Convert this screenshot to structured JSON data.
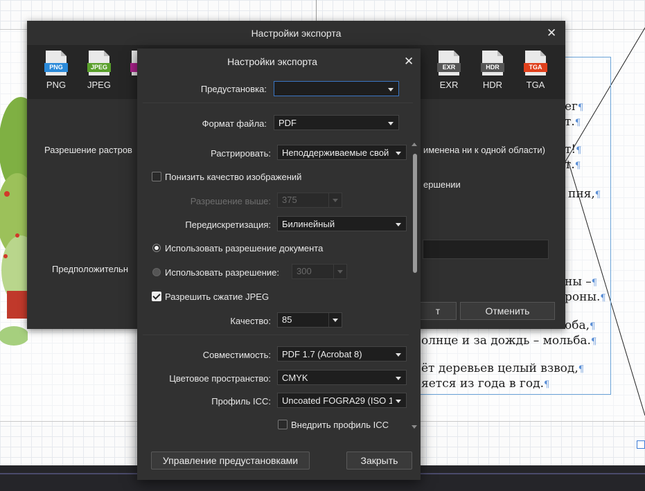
{
  "document": {
    "lines": [
      {
        "text": "ег",
        "pilcrow": "¶"
      },
      {
        "text": "т.",
        "pilcrow": "¶"
      },
      {
        "text": "т!",
        "pilcrow": "¶"
      },
      {
        "text": "т.",
        "pilcrow": "¶"
      },
      {
        "text": "пня,",
        "pilcrow": "¶"
      },
      {
        "text": "ны –",
        "pilcrow": "¶"
      },
      {
        "text": "роны.",
        "pilcrow": "¶"
      },
      {
        "text": "оба,",
        "pilcrow": "¶"
      },
      {
        "text": "олнце и за дождь – мольба.",
        "pilcrow": "¶"
      },
      {
        "text": "ёт деревьев целый взвод,",
        "pilcrow": "¶"
      },
      {
        "text": "яется из года в год.",
        "pilcrow": "¶"
      }
    ]
  },
  "back_dialog": {
    "title": "Настройки экспорта",
    "close_glyph": "✕",
    "formats": [
      {
        "label": "PNG",
        "tag": "PNG",
        "color": "#2b8ad9"
      },
      {
        "label": "JPEG",
        "tag": "JPEG",
        "color": "#5aa02c"
      },
      {
        "label": "",
        "tag": "",
        "color": "#b0218f"
      },
      {
        "label": "EXR",
        "tag": "EXR",
        "color": "#555555"
      },
      {
        "label": "HDR",
        "tag": "HDR",
        "color": "#555555"
      },
      {
        "label": "TGA",
        "tag": "TGA",
        "color": "#e0401c"
      }
    ],
    "raster_label": "Разрешение растров",
    "raster_note": "именена ни к одной области)",
    "completion_note": "ершении",
    "estimated_label": "Предположительн",
    "export_btn": "т",
    "cancel_btn": "Отменить"
  },
  "front_dialog": {
    "title": "Настройки экспорта",
    "close_glyph": "✕",
    "preset_label": "Предустановка:",
    "preset_value": "",
    "file_format_label": "Формат файла:",
    "file_format_value": "PDF",
    "rasterize_label": "Растрировать:",
    "rasterize_value": "Неподдерживаемые свой",
    "downsample_label": "Понизить качество изображений",
    "downsample_checked": false,
    "resolution_above_label": "Разрешение выше:",
    "resolution_above_value": "375",
    "resample_label": "Передискретизация:",
    "resample_value": "Билинейный",
    "use_doc_resolution_label": "Использовать разрешение документа",
    "use_resolution_label": "Использовать разрешение:",
    "use_resolution_value": "300",
    "allow_jpeg_label": "Разрешить сжатие JPEG",
    "allow_jpeg_checked": true,
    "quality_label": "Качество:",
    "quality_value": "85",
    "compat_label": "Совместимость:",
    "compat_value": "PDF 1.7 (Acrobat 8)",
    "colorspace_label": "Цветовое пространство:",
    "colorspace_value": "CMYK",
    "icc_label": "Профиль ICC:",
    "icc_value": "Uncoated FOGRA29 (ISO 1",
    "embed_icc_label": "Внедрить профиль ICC",
    "embed_icc_checked": false,
    "manage_presets_btn": "Управление предустановками",
    "close_btn": "Закрыть"
  }
}
